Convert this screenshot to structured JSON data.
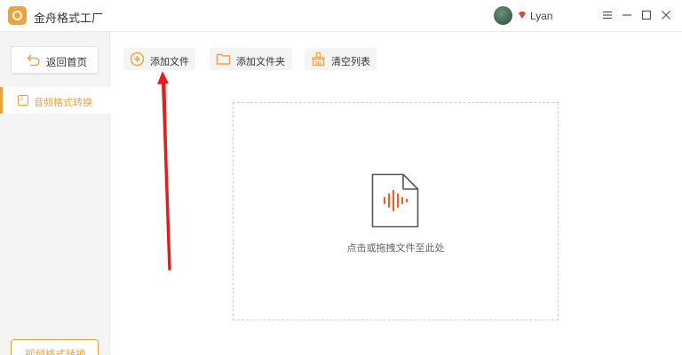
{
  "app": {
    "title": "金舟格式工厂",
    "logo_icon": "app-logo-icon",
    "accent_color": "#f0a23a"
  },
  "user": {
    "name": "Lyan",
    "vip_icon": "vip-diamond-icon",
    "vip_color": "#e0473a"
  },
  "window_controls": [
    "menu-icon",
    "minimize-icon",
    "maximize-icon",
    "close-icon"
  ],
  "sidebar": {
    "back_label": "返回首页",
    "active_item": "音频格式转换",
    "bottom_item": "视频格式转换"
  },
  "toolbar": {
    "add_file": "添加文件",
    "add_folder": "添加文件夹",
    "clear_list": "清空列表"
  },
  "dropzone": {
    "hint": "点击或拖拽文件至此处",
    "icon": "audio-file-icon"
  },
  "annotation": {
    "arrow_color": "#e02020"
  }
}
